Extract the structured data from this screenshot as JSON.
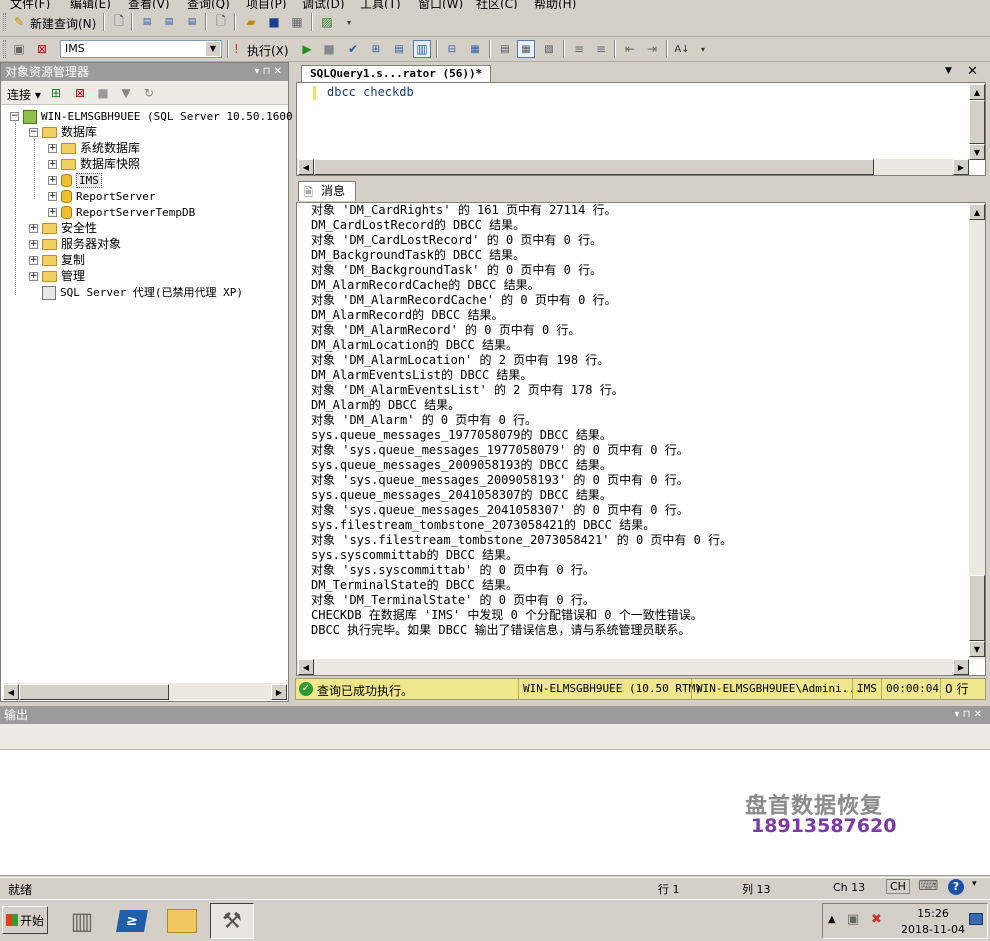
{
  "menu": [
    "文件(F)",
    "编辑(E)",
    "查看(V)",
    "查询(Q)",
    "项目(P)",
    "调试(D)",
    "工具(T)",
    "窗口(W)",
    "社区(C)",
    "帮助(H)"
  ],
  "toolbar1": {
    "new_query": "新建查询(N)"
  },
  "toolbar2": {
    "database": "IMS",
    "execute": "执行(X)"
  },
  "object_explorer": {
    "title": "对象资源管理器",
    "pin": "▾ ⊓ ✕",
    "connect": "连接",
    "tree": {
      "server": "WIN-ELMSGBH9UEE (SQL Server 10.50.1600 -",
      "databases": "数据库",
      "system_databases": "系统数据库",
      "snapshots": "数据库快照",
      "db_ims": "IMS",
      "db_report": "ReportServer",
      "db_report_temp": "ReportServerTempDB",
      "security": "安全性",
      "server_objects": "服务器对象",
      "replication": "复制",
      "management": "管理",
      "agent": "SQL Server 代理(已禁用代理 XP)"
    }
  },
  "editor": {
    "tab": "SQLQuery1.s...rator (56))*",
    "code": "dbcc checkdb"
  },
  "messages": {
    "tab": "消息",
    "lines": [
      "对象 'DM_CardRights' 的 161 页中有 27114 行。",
      "DM_CardLostRecord的 DBCC 结果。",
      "对象 'DM_CardLostRecord' 的 0 页中有 0 行。",
      "DM_BackgroundTask的 DBCC 结果。",
      "对象 'DM_BackgroundTask' 的 0 页中有 0 行。",
      "DM_AlarmRecordCache的 DBCC 结果。",
      "对象 'DM_AlarmRecordCache' 的 0 页中有 0 行。",
      "DM_AlarmRecord的 DBCC 结果。",
      "对象 'DM_AlarmRecord' 的 0 页中有 0 行。",
      "DM_AlarmLocation的 DBCC 结果。",
      "对象 'DM_AlarmLocation' 的 2 页中有 198 行。",
      "DM_AlarmEventsList的 DBCC 结果。",
      "对象 'DM_AlarmEventsList' 的 2 页中有 178 行。",
      "DM_Alarm的 DBCC 结果。",
      "对象 'DM_Alarm' 的 0 页中有 0 行。",
      "sys.queue_messages_1977058079的 DBCC 结果。",
      "对象 'sys.queue_messages_1977058079' 的 0 页中有 0 行。",
      "sys.queue_messages_2009058193的 DBCC 结果。",
      "对象 'sys.queue_messages_2009058193' 的 0 页中有 0 行。",
      "sys.queue_messages_2041058307的 DBCC 结果。",
      "对象 'sys.queue_messages_2041058307' 的 0 页中有 0 行。",
      "sys.filestream_tombstone_2073058421的 DBCC 结果。",
      "对象 'sys.filestream_tombstone_2073058421' 的 0 页中有 0 行。",
      "sys.syscommittab的 DBCC 结果。",
      "对象 'sys.syscommittab' 的 0 页中有 0 行。",
      "DM_TerminalState的 DBCC 结果。",
      "对象 'DM_TerminalState' 的 0 页中有 0 行。",
      "CHECKDB 在数据库 'IMS' 中发现 0 个分配错误和 0 个一致性错误。",
      "DBCC 执行完毕。如果 DBCC 输出了错误信息，请与系统管理员联系。"
    ]
  },
  "query_status": {
    "message": "查询已成功执行。",
    "server": "WIN-ELMSGBH9UEE (10.50 RTM)",
    "user": "WIN-ELMSGBH9UEE\\Admini...",
    "database": "IMS",
    "elapsed": "00:00:04",
    "rows": "0 行"
  },
  "output": {
    "title": "输出"
  },
  "status_bar": {
    "ready": "就绪",
    "line": "行 1",
    "col": "列 13",
    "ch": "Ch 13",
    "ins": "CH"
  },
  "taskbar": {
    "start": "开始",
    "time": "15:26",
    "date": "2018-11-04"
  },
  "watermark": {
    "name": "盘首数据恢复",
    "phone": "18913587620"
  }
}
